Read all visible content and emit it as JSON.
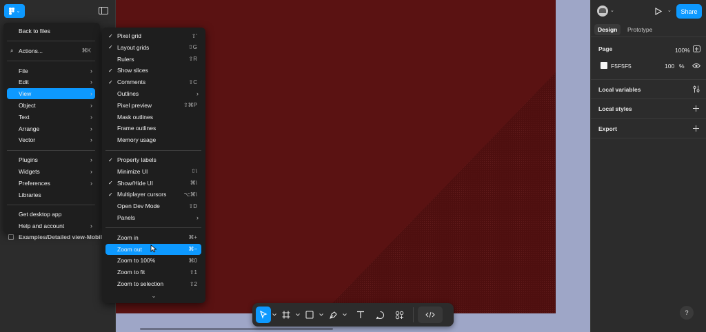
{
  "colors": {
    "accent": "#0d99ff",
    "frame": "#5a1212",
    "canvas": "#9ea6c7",
    "panel": "#2c2c2c",
    "menu": "#1e1e1e"
  },
  "left_panel": {
    "page_item": "Examples/Detailed view-Mobile"
  },
  "main_menu": {
    "groups": [
      [
        {
          "label": "Back to files"
        }
      ],
      [
        {
          "label": "Actions...",
          "shortcut": "⌘K",
          "icon": "search-icon"
        }
      ],
      [
        {
          "label": "File",
          "submenu": true
        },
        {
          "label": "Edit",
          "submenu": true
        },
        {
          "label": "View",
          "submenu": true,
          "highlighted": true
        },
        {
          "label": "Object",
          "submenu": true
        },
        {
          "label": "Text",
          "submenu": true
        },
        {
          "label": "Arrange",
          "submenu": true
        },
        {
          "label": "Vector",
          "submenu": true
        }
      ],
      [
        {
          "label": "Plugins",
          "submenu": true
        },
        {
          "label": "Widgets",
          "submenu": true
        },
        {
          "label": "Preferences",
          "submenu": true
        },
        {
          "label": "Libraries"
        }
      ],
      [
        {
          "label": "Get desktop app"
        },
        {
          "label": "Help and account",
          "submenu": true
        }
      ]
    ]
  },
  "view_menu": {
    "groups": [
      [
        {
          "label": "Pixel grid",
          "shortcut": "⇧'",
          "checked": true
        },
        {
          "label": "Layout grids",
          "shortcut": "⇧G",
          "checked": true
        },
        {
          "label": "Rulers",
          "shortcut": "⇧R"
        },
        {
          "label": "Show slices",
          "checked": true
        },
        {
          "label": "Comments",
          "shortcut": "⇧C",
          "checked": true
        },
        {
          "label": "Outlines",
          "submenu": true
        },
        {
          "label": "Pixel preview",
          "shortcut": "⇧⌘P"
        },
        {
          "label": "Mask outlines"
        },
        {
          "label": "Frame outlines"
        },
        {
          "label": "Memory usage"
        }
      ],
      [
        {
          "label": "Property labels",
          "checked": true
        },
        {
          "label": "Minimize UI",
          "shortcut": "⇧\\"
        },
        {
          "label": "Show/Hide UI",
          "shortcut": "⌘\\",
          "checked": true
        },
        {
          "label": "Multiplayer cursors",
          "shortcut": "⌥⌘\\",
          "checked": true
        },
        {
          "label": "Open Dev Mode",
          "shortcut": "⇧D"
        },
        {
          "label": "Panels",
          "submenu": true
        }
      ],
      [
        {
          "label": "Zoom in",
          "shortcut": "⌘+"
        },
        {
          "label": "Zoom out",
          "shortcut": "⌘−",
          "highlighted": true
        },
        {
          "label": "Zoom to 100%",
          "shortcut": "⌘0"
        },
        {
          "label": "Zoom to fit",
          "shortcut": "⇧1"
        },
        {
          "label": "Zoom to selection",
          "shortcut": "⇧2"
        }
      ]
    ],
    "more_indicator": "⌄"
  },
  "toolbar": {
    "tools": [
      "move-tool-icon",
      "frame-tool-icon",
      "shape-tool-icon",
      "pen-tool-icon",
      "text-tool-icon",
      "comment-tool-icon",
      "actions-tool-icon",
      "dev-mode-icon"
    ]
  },
  "right_panel": {
    "share_label": "Share",
    "tabs": [
      "Design",
      "Prototype"
    ],
    "zoom": "100%",
    "page_section": {
      "title": "Page",
      "fill_hex": "F5F5F5",
      "fill_opacity": "100",
      "percent": "%"
    },
    "local_variables": "Local variables",
    "local_styles": "Local styles",
    "export": "Export",
    "help": "?"
  }
}
